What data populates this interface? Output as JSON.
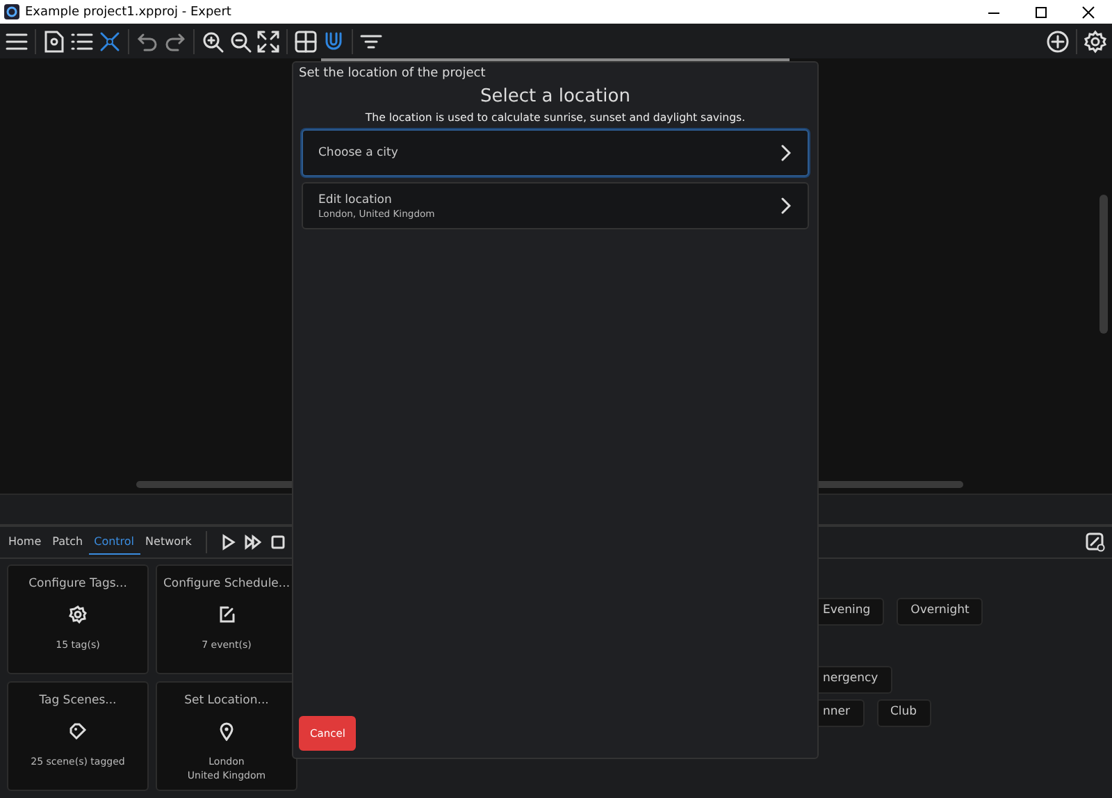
{
  "window": {
    "title": "Example project1.xpproj - Expert"
  },
  "bottom_tabs": [
    {
      "label": "Home",
      "selected": false
    },
    {
      "label": "Patch",
      "selected": false
    },
    {
      "label": "Control",
      "selected": true
    },
    {
      "label": "Network",
      "selected": false
    }
  ],
  "cards": [
    {
      "title": "Configure Tags...",
      "detail": "15 tag(s)"
    },
    {
      "title": "Configure Schedule...",
      "detail": "7 event(s)"
    },
    {
      "title": "Tag Scenes...",
      "detail": "25 scene(s) tagged"
    },
    {
      "title": "Set Location...",
      "detail": "London\nUnited Kingdom"
    }
  ],
  "chip_rows": [
    [
      "Evening",
      "Overnight"
    ],
    [
      "nergency"
    ],
    [
      "nner",
      "Club"
    ]
  ],
  "dialog": {
    "header": "Set the location of the project",
    "title": "Select a location",
    "subtitle": "The location is used to calculate sunrise, sunset and daylight savings.",
    "options": [
      {
        "title": "Choose a city",
        "focused": true
      },
      {
        "title": "Edit location",
        "subtitle": "London, United Kingdom",
        "focused": false
      }
    ],
    "cancel": "Cancel"
  }
}
